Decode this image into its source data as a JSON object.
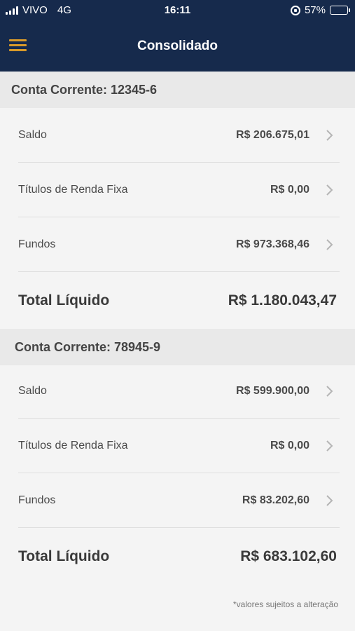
{
  "status_bar": {
    "carrier": "VIVO",
    "network": "4G",
    "time": "16:11",
    "battery_percent": "57%",
    "battery_level": 0.57
  },
  "nav": {
    "title": "Consolidado"
  },
  "accounts": [
    {
      "header": "Conta Corrente: 12345-6",
      "rows": [
        {
          "label": "Saldo",
          "value": "R$ 206.675,01"
        },
        {
          "label": "Títulos de Renda Fixa",
          "value": "R$ 0,00"
        },
        {
          "label": "Fundos",
          "value": "R$ 973.368,46"
        }
      ],
      "total_label": "Total Líquido",
      "total_value": "R$ 1.180.043,47"
    },
    {
      "header": "Conta Corrente:  78945-9",
      "rows": [
        {
          "label": "Saldo",
          "value": "R$ 599.900,00"
        },
        {
          "label": "Títulos de Renda Fixa",
          "value": "R$ 0,00"
        },
        {
          "label": "Fundos",
          "value": "R$ 83.202,60"
        }
      ],
      "total_label": "Total Líquido",
      "total_value": "R$ 683.102,60"
    }
  ],
  "footnote": "*valores sujeitos a alteração",
  "colors": {
    "header_bg": "#162a4c",
    "menu_accent": "#d89a2a",
    "section_bg": "#e9e9e9",
    "page_bg": "#f4f4f4"
  }
}
